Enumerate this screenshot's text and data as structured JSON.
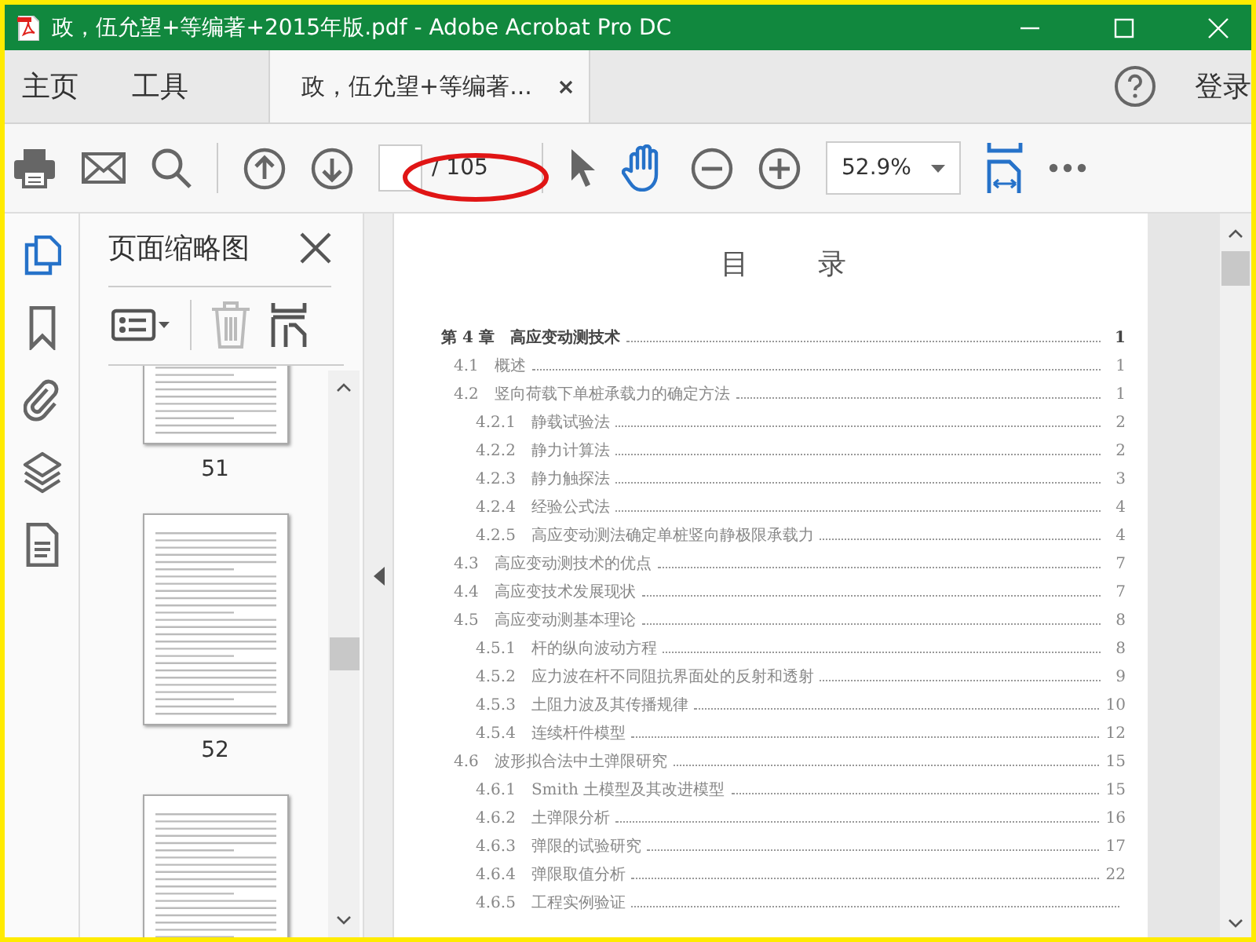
{
  "window": {
    "title": "政，伍允望+等编著+2015年版.pdf - Adobe Acrobat Pro DC"
  },
  "tabs": [
    {
      "label": "主页",
      "kind": "nav",
      "selected": false
    },
    {
      "label": "工具",
      "kind": "nav",
      "selected": false
    },
    {
      "label": "政，伍允望+等编著...",
      "kind": "document",
      "selected": true
    }
  ],
  "account": {
    "label": "登录"
  },
  "toolbar": {
    "page_total": "/ 105",
    "zoom": "52.9%",
    "annotation": {
      "kind": "ellipse"
    },
    "tools": [
      {
        "kind": "select",
        "selected": false
      },
      {
        "kind": "hand",
        "selected": true
      }
    ]
  },
  "sidebar": {
    "rail": [
      {
        "kind": "pages",
        "selected": true
      },
      {
        "kind": "bookmark",
        "selected": false
      },
      {
        "kind": "attachment",
        "selected": false
      },
      {
        "kind": "layers",
        "selected": false
      },
      {
        "kind": "document",
        "selected": false
      }
    ],
    "panel": {
      "title": "页面缩略图",
      "thumbnails": [
        {
          "kind": "page",
          "label": "51"
        },
        {
          "kind": "page",
          "label": "52"
        },
        {
          "kind": "page"
        }
      ]
    }
  },
  "document": {
    "heading": "目录",
    "toc": [
      {
        "kind": "chapter",
        "number": "第 4 章",
        "title": "高应变动测技术",
        "page": "1"
      },
      {
        "kind": "section",
        "number": "4.1",
        "title": "概述",
        "page": "1"
      },
      {
        "kind": "section",
        "number": "4.2",
        "title": "竖向荷载下单桩承载力的确定方法",
        "page": "1"
      },
      {
        "kind": "subsection",
        "number": "4.2.1",
        "title": "静载试验法",
        "page": "2"
      },
      {
        "kind": "subsection",
        "number": "4.2.2",
        "title": "静力计算法",
        "page": "2"
      },
      {
        "kind": "subsection",
        "number": "4.2.3",
        "title": "静力触探法",
        "page": "3"
      },
      {
        "kind": "subsection",
        "number": "4.2.4",
        "title": "经验公式法",
        "page": "4"
      },
      {
        "kind": "subsection",
        "number": "4.2.5",
        "title": "高应变动测法确定单桩竖向静极限承载力",
        "page": "4"
      },
      {
        "kind": "section",
        "number": "4.3",
        "title": "高应变动测技术的优点",
        "page": "7"
      },
      {
        "kind": "section",
        "number": "4.4",
        "title": "高应变技术发展现状",
        "page": "7"
      },
      {
        "kind": "section",
        "number": "4.5",
        "title": "高应变动测基本理论",
        "page": "8"
      },
      {
        "kind": "subsection",
        "number": "4.5.1",
        "title": "杆的纵向波动方程",
        "page": "8"
      },
      {
        "kind": "subsection",
        "number": "4.5.2",
        "title": "应力波在杆不同阻抗界面处的反射和透射",
        "page": "9"
      },
      {
        "kind": "subsection",
        "number": "4.5.3",
        "title": "土阻力波及其传播规律",
        "page": "10"
      },
      {
        "kind": "subsection",
        "number": "4.5.4",
        "title": "连续杆件模型",
        "page": "12"
      },
      {
        "kind": "section",
        "number": "4.6",
        "title": "波形拟合法中土弹限研究",
        "page": "15"
      },
      {
        "kind": "subsection",
        "number": "4.6.1",
        "title": "Smith 土模型及其改进模型",
        "page": "15"
      },
      {
        "kind": "subsection",
        "number": "4.6.2",
        "title": "土弹限分析",
        "page": "16"
      },
      {
        "kind": "subsection",
        "number": "4.6.3",
        "title": "弹限的试验研究",
        "page": "17"
      },
      {
        "kind": "subsection",
        "number": "4.6.4",
        "title": "弹限取值分析",
        "page": "22"
      },
      {
        "kind": "subsection",
        "number": "4.6.5",
        "title": "工程实例验证"
      }
    ]
  }
}
